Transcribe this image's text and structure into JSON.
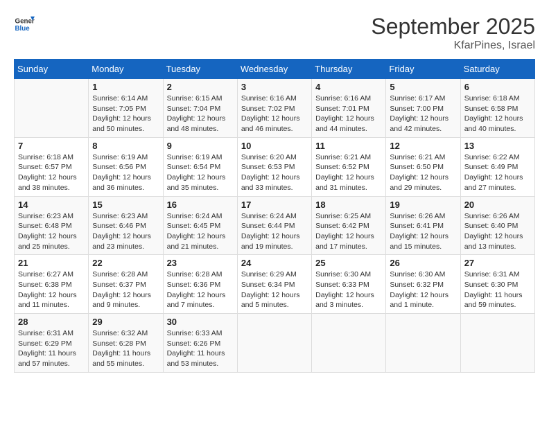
{
  "logo": {
    "line1": "General",
    "line2": "Blue"
  },
  "title": "September 2025",
  "location": "KfarPines, Israel",
  "days_of_week": [
    "Sunday",
    "Monday",
    "Tuesday",
    "Wednesday",
    "Thursday",
    "Friday",
    "Saturday"
  ],
  "weeks": [
    [
      {
        "day": "",
        "info": ""
      },
      {
        "day": "1",
        "info": "Sunrise: 6:14 AM\nSunset: 7:05 PM\nDaylight: 12 hours\nand 50 minutes."
      },
      {
        "day": "2",
        "info": "Sunrise: 6:15 AM\nSunset: 7:04 PM\nDaylight: 12 hours\nand 48 minutes."
      },
      {
        "day": "3",
        "info": "Sunrise: 6:16 AM\nSunset: 7:02 PM\nDaylight: 12 hours\nand 46 minutes."
      },
      {
        "day": "4",
        "info": "Sunrise: 6:16 AM\nSunset: 7:01 PM\nDaylight: 12 hours\nand 44 minutes."
      },
      {
        "day": "5",
        "info": "Sunrise: 6:17 AM\nSunset: 7:00 PM\nDaylight: 12 hours\nand 42 minutes."
      },
      {
        "day": "6",
        "info": "Sunrise: 6:18 AM\nSunset: 6:58 PM\nDaylight: 12 hours\nand 40 minutes."
      }
    ],
    [
      {
        "day": "7",
        "info": "Sunrise: 6:18 AM\nSunset: 6:57 PM\nDaylight: 12 hours\nand 38 minutes."
      },
      {
        "day": "8",
        "info": "Sunrise: 6:19 AM\nSunset: 6:56 PM\nDaylight: 12 hours\nand 36 minutes."
      },
      {
        "day": "9",
        "info": "Sunrise: 6:19 AM\nSunset: 6:54 PM\nDaylight: 12 hours\nand 35 minutes."
      },
      {
        "day": "10",
        "info": "Sunrise: 6:20 AM\nSunset: 6:53 PM\nDaylight: 12 hours\nand 33 minutes."
      },
      {
        "day": "11",
        "info": "Sunrise: 6:21 AM\nSunset: 6:52 PM\nDaylight: 12 hours\nand 31 minutes."
      },
      {
        "day": "12",
        "info": "Sunrise: 6:21 AM\nSunset: 6:50 PM\nDaylight: 12 hours\nand 29 minutes."
      },
      {
        "day": "13",
        "info": "Sunrise: 6:22 AM\nSunset: 6:49 PM\nDaylight: 12 hours\nand 27 minutes."
      }
    ],
    [
      {
        "day": "14",
        "info": "Sunrise: 6:23 AM\nSunset: 6:48 PM\nDaylight: 12 hours\nand 25 minutes."
      },
      {
        "day": "15",
        "info": "Sunrise: 6:23 AM\nSunset: 6:46 PM\nDaylight: 12 hours\nand 23 minutes."
      },
      {
        "day": "16",
        "info": "Sunrise: 6:24 AM\nSunset: 6:45 PM\nDaylight: 12 hours\nand 21 minutes."
      },
      {
        "day": "17",
        "info": "Sunrise: 6:24 AM\nSunset: 6:44 PM\nDaylight: 12 hours\nand 19 minutes."
      },
      {
        "day": "18",
        "info": "Sunrise: 6:25 AM\nSunset: 6:42 PM\nDaylight: 12 hours\nand 17 minutes."
      },
      {
        "day": "19",
        "info": "Sunrise: 6:26 AM\nSunset: 6:41 PM\nDaylight: 12 hours\nand 15 minutes."
      },
      {
        "day": "20",
        "info": "Sunrise: 6:26 AM\nSunset: 6:40 PM\nDaylight: 12 hours\nand 13 minutes."
      }
    ],
    [
      {
        "day": "21",
        "info": "Sunrise: 6:27 AM\nSunset: 6:38 PM\nDaylight: 12 hours\nand 11 minutes."
      },
      {
        "day": "22",
        "info": "Sunrise: 6:28 AM\nSunset: 6:37 PM\nDaylight: 12 hours\nand 9 minutes."
      },
      {
        "day": "23",
        "info": "Sunrise: 6:28 AM\nSunset: 6:36 PM\nDaylight: 12 hours\nand 7 minutes."
      },
      {
        "day": "24",
        "info": "Sunrise: 6:29 AM\nSunset: 6:34 PM\nDaylight: 12 hours\nand 5 minutes."
      },
      {
        "day": "25",
        "info": "Sunrise: 6:30 AM\nSunset: 6:33 PM\nDaylight: 12 hours\nand 3 minutes."
      },
      {
        "day": "26",
        "info": "Sunrise: 6:30 AM\nSunset: 6:32 PM\nDaylight: 12 hours\nand 1 minute."
      },
      {
        "day": "27",
        "info": "Sunrise: 6:31 AM\nSunset: 6:30 PM\nDaylight: 11 hours\nand 59 minutes."
      }
    ],
    [
      {
        "day": "28",
        "info": "Sunrise: 6:31 AM\nSunset: 6:29 PM\nDaylight: 11 hours\nand 57 minutes."
      },
      {
        "day": "29",
        "info": "Sunrise: 6:32 AM\nSunset: 6:28 PM\nDaylight: 11 hours\nand 55 minutes."
      },
      {
        "day": "30",
        "info": "Sunrise: 6:33 AM\nSunset: 6:26 PM\nDaylight: 11 hours\nand 53 minutes."
      },
      {
        "day": "",
        "info": ""
      },
      {
        "day": "",
        "info": ""
      },
      {
        "day": "",
        "info": ""
      },
      {
        "day": "",
        "info": ""
      }
    ]
  ]
}
